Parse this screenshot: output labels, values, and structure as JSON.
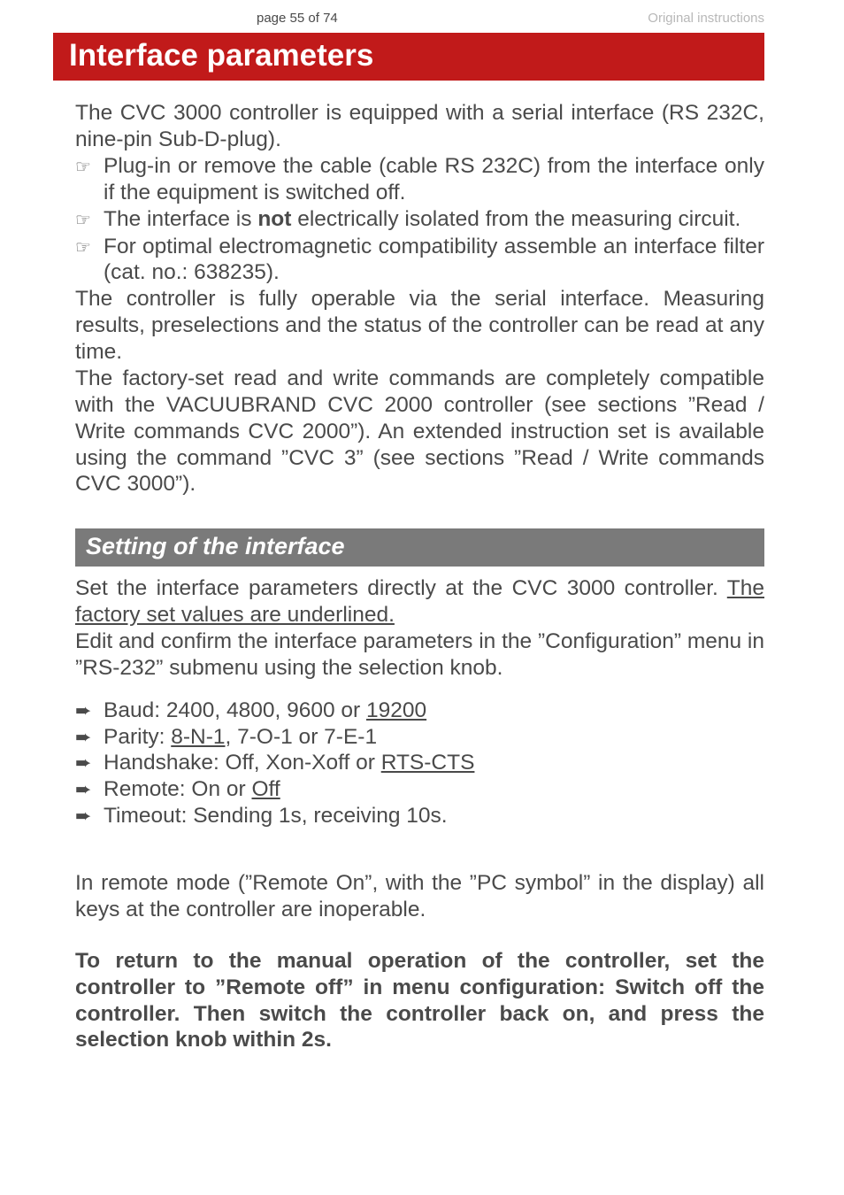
{
  "header": {
    "page_indicator": "page 55 of 74",
    "doc_type": "Original instructions"
  },
  "title": "Interface parameters",
  "intro": "The CVC 3000 controller is equipped with a serial interface (RS 232C, nine-pin Sub-D-plug).",
  "note1": "Plug-in or remove the cable (cable RS 232C) from the interface only if the equipment is switched off.",
  "note2_pre": "The interface is ",
  "note2_bold": "not",
  "note2_post": " electrically isolated from the measuring circuit.",
  "note3": "For optimal electromagnetic compatibility assemble an interface filter (cat. no.: 638235).",
  "para2": "The controller is fully operable via the serial interface. Measuring results, preselections and the status of the controller can be read at any time.",
  "para3": "The factory-set read and write commands are completely compatible with the VACUUBRAND CVC 2000 controller (see sections ”Read / Write commands CVC 2000”). An extended instruction set is available using the command ”CVC 3” (see sections ”Read / Write commands CVC 3000”).",
  "subhead": "Setting of the interface",
  "set_intro_pre": "Set the interface parameters directly at the CVC 3000 controller. ",
  "set_intro_u": "The factory set values are underlined.",
  "set_intro2": "Edit and confirm the interface parameters in the ”Configuration” menu in ”RS-232” submenu using the selection knob.",
  "list": {
    "baud_pre": "Baud: 2400, 4800, 9600 or ",
    "baud_u": "19200",
    "parity_pre": "Parity: ",
    "parity_u": "8-N-1",
    "parity_post": ", 7-O-1 or 7-E-1",
    "hs_pre": "Handshake: Off, Xon-Xoff or ",
    "hs_u": "RTS-CTS",
    "remote_pre": "Remote: On or ",
    "remote_u": "Off",
    "timeout": "Timeout: Sending 1s, receiving 10s."
  },
  "remote_para": "In remote mode (”Remote On”, with the ”PC symbol” in the display) all keys at the controller are inoperable.",
  "bold_para": "To return to the manual operation of the controller, set the controller to ”Remote off” in menu configuration:  Switch off the controller. Then switch the controller back on, and press the selection knob within 2s.",
  "icons": {
    "hand": "☞",
    "arrow": "➨"
  }
}
